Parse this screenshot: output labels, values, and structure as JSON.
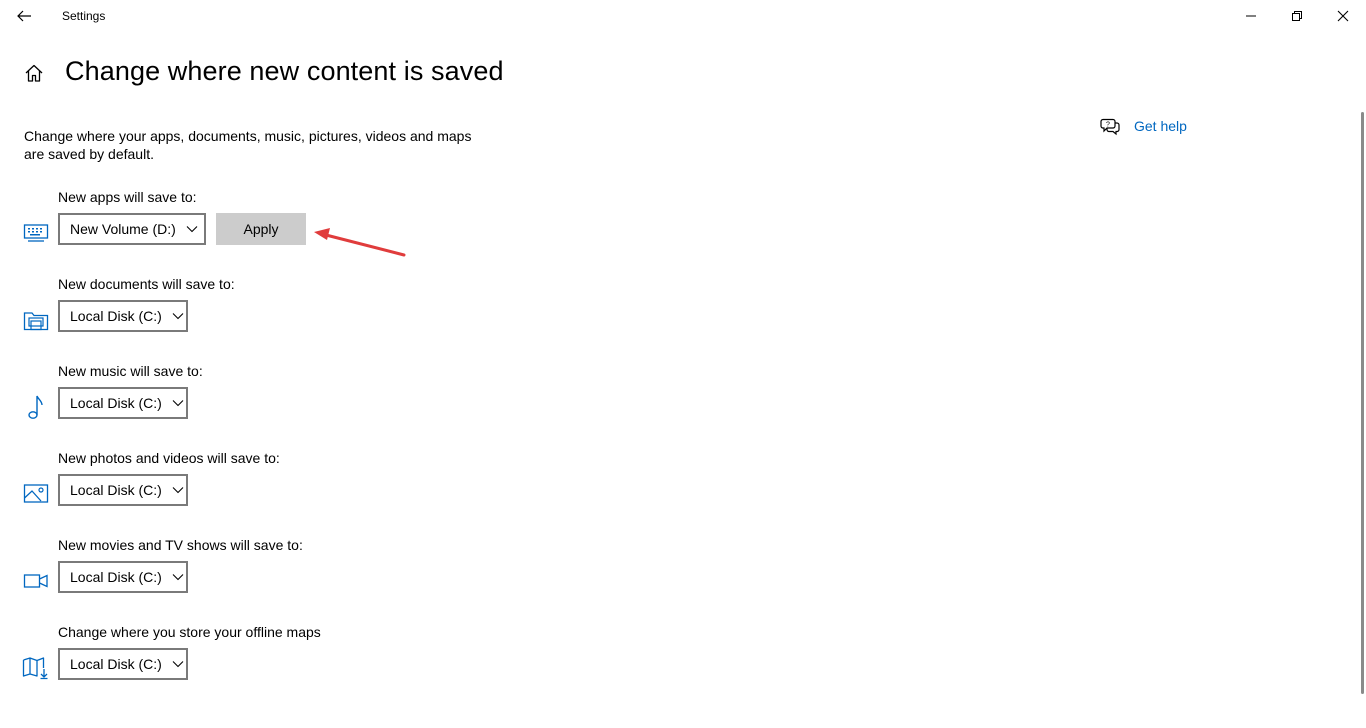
{
  "window": {
    "title": "Settings",
    "controls": {
      "minimize_icon": "minimize-icon",
      "maximize_icon": "restore-icon",
      "close_icon": "close-icon"
    }
  },
  "page": {
    "title": "Change where new content is saved",
    "description": "Change where your apps, documents, music, pictures, videos and maps are saved by default."
  },
  "help": {
    "label": "Get help",
    "icon": "help-chat-icon"
  },
  "settings": [
    {
      "label": "New apps will save to:",
      "icon": "monitor-keyboard-icon",
      "value": "New Volume (D:)",
      "apply_label": "Apply"
    },
    {
      "label": "New documents will save to:",
      "icon": "documents-folder-icon",
      "value": "Local Disk (C:)"
    },
    {
      "label": "New music will save to:",
      "icon": "music-note-icon",
      "value": "Local Disk (C:)"
    },
    {
      "label": "New photos and videos will save to:",
      "icon": "picture-icon",
      "value": "Local Disk (C:)"
    },
    {
      "label": "New movies and TV shows will save to:",
      "icon": "video-camera-icon",
      "value": "Local Disk (C:)"
    },
    {
      "label": "Change where you store your offline maps",
      "icon": "offline-map-icon",
      "value": "Local Disk (C:)"
    }
  ],
  "colors": {
    "accent": "#0067c0",
    "annotation": "#e03c3c",
    "apply_bg": "#cccccc",
    "dropdown_border": "#7a7a7a"
  }
}
